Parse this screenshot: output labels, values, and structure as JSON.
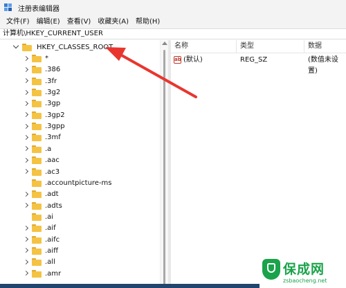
{
  "window": {
    "title": "注册表编辑器"
  },
  "menu": {
    "items": [
      "文件(F)",
      "编辑(E)",
      "查看(V)",
      "收藏夹(A)",
      "帮助(H)"
    ]
  },
  "address": {
    "path": "计算机\\HKEY_CURRENT_USER"
  },
  "tree": {
    "root": "HKEY_CLASSES_ROOT",
    "items": [
      {
        "label": "*",
        "expandable": true
      },
      {
        "label": ".386",
        "expandable": true
      },
      {
        "label": ".3fr",
        "expandable": true
      },
      {
        "label": ".3g2",
        "expandable": true
      },
      {
        "label": ".3gp",
        "expandable": true
      },
      {
        "label": ".3gp2",
        "expandable": true
      },
      {
        "label": ".3gpp",
        "expandable": true
      },
      {
        "label": ".3mf",
        "expandable": true
      },
      {
        "label": ".a",
        "expandable": true
      },
      {
        "label": ".aac",
        "expandable": true
      },
      {
        "label": ".ac3",
        "expandable": true
      },
      {
        "label": ".accountpicture-ms",
        "expandable": false
      },
      {
        "label": ".adt",
        "expandable": true
      },
      {
        "label": ".adts",
        "expandable": true
      },
      {
        "label": ".ai",
        "expandable": false
      },
      {
        "label": ".aif",
        "expandable": true
      },
      {
        "label": ".aifc",
        "expandable": true
      },
      {
        "label": ".aiff",
        "expandable": true
      },
      {
        "label": ".all",
        "expandable": true
      },
      {
        "label": ".amr",
        "expandable": true
      }
    ]
  },
  "values_table": {
    "headers": [
      "名称",
      "类型",
      "数据"
    ],
    "rows": [
      {
        "name": "(默认)",
        "type": "REG_SZ",
        "data": "(数值未设置)",
        "icon": "ab-string-icon"
      }
    ]
  },
  "watermark": {
    "title": "保成网",
    "url": "zsbaocheng.net"
  },
  "colors": {
    "folder": "#f5c343",
    "arrow": "#e8362f",
    "watermark": "#1aa34a"
  }
}
